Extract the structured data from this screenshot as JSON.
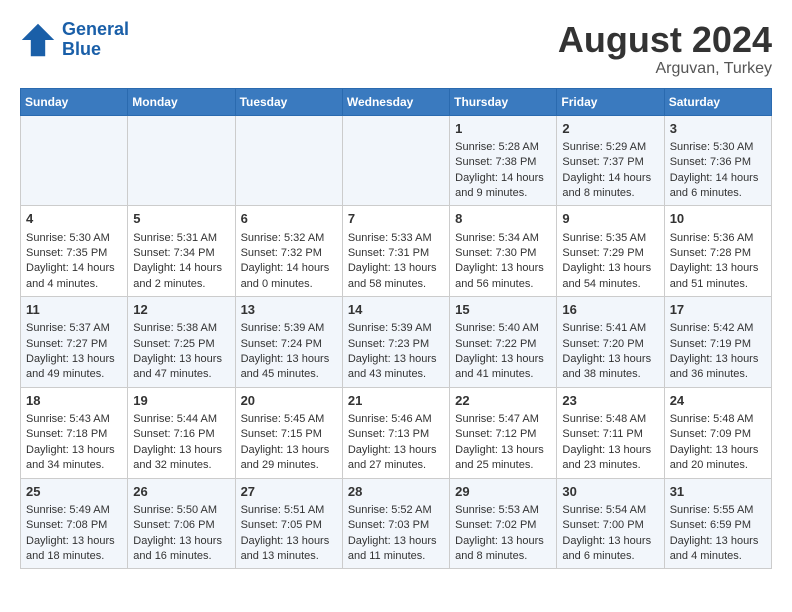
{
  "header": {
    "logo_line1": "General",
    "logo_line2": "Blue",
    "month_year": "August 2024",
    "location": "Arguvan, Turkey"
  },
  "days_of_week": [
    "Sunday",
    "Monday",
    "Tuesday",
    "Wednesday",
    "Thursday",
    "Friday",
    "Saturday"
  ],
  "weeks": [
    {
      "cells": [
        {
          "day": "",
          "content": ""
        },
        {
          "day": "",
          "content": ""
        },
        {
          "day": "",
          "content": ""
        },
        {
          "day": "",
          "content": ""
        },
        {
          "day": "1",
          "content": "Sunrise: 5:28 AM\nSunset: 7:38 PM\nDaylight: 14 hours\nand 9 minutes."
        },
        {
          "day": "2",
          "content": "Sunrise: 5:29 AM\nSunset: 7:37 PM\nDaylight: 14 hours\nand 8 minutes."
        },
        {
          "day": "3",
          "content": "Sunrise: 5:30 AM\nSunset: 7:36 PM\nDaylight: 14 hours\nand 6 minutes."
        }
      ]
    },
    {
      "cells": [
        {
          "day": "4",
          "content": "Sunrise: 5:30 AM\nSunset: 7:35 PM\nDaylight: 14 hours\nand 4 minutes."
        },
        {
          "day": "5",
          "content": "Sunrise: 5:31 AM\nSunset: 7:34 PM\nDaylight: 14 hours\nand 2 minutes."
        },
        {
          "day": "6",
          "content": "Sunrise: 5:32 AM\nSunset: 7:32 PM\nDaylight: 14 hours\nand 0 minutes."
        },
        {
          "day": "7",
          "content": "Sunrise: 5:33 AM\nSunset: 7:31 PM\nDaylight: 13 hours\nand 58 minutes."
        },
        {
          "day": "8",
          "content": "Sunrise: 5:34 AM\nSunset: 7:30 PM\nDaylight: 13 hours\nand 56 minutes."
        },
        {
          "day": "9",
          "content": "Sunrise: 5:35 AM\nSunset: 7:29 PM\nDaylight: 13 hours\nand 54 minutes."
        },
        {
          "day": "10",
          "content": "Sunrise: 5:36 AM\nSunset: 7:28 PM\nDaylight: 13 hours\nand 51 minutes."
        }
      ]
    },
    {
      "cells": [
        {
          "day": "11",
          "content": "Sunrise: 5:37 AM\nSunset: 7:27 PM\nDaylight: 13 hours\nand 49 minutes."
        },
        {
          "day": "12",
          "content": "Sunrise: 5:38 AM\nSunset: 7:25 PM\nDaylight: 13 hours\nand 47 minutes."
        },
        {
          "day": "13",
          "content": "Sunrise: 5:39 AM\nSunset: 7:24 PM\nDaylight: 13 hours\nand 45 minutes."
        },
        {
          "day": "14",
          "content": "Sunrise: 5:39 AM\nSunset: 7:23 PM\nDaylight: 13 hours\nand 43 minutes."
        },
        {
          "day": "15",
          "content": "Sunrise: 5:40 AM\nSunset: 7:22 PM\nDaylight: 13 hours\nand 41 minutes."
        },
        {
          "day": "16",
          "content": "Sunrise: 5:41 AM\nSunset: 7:20 PM\nDaylight: 13 hours\nand 38 minutes."
        },
        {
          "day": "17",
          "content": "Sunrise: 5:42 AM\nSunset: 7:19 PM\nDaylight: 13 hours\nand 36 minutes."
        }
      ]
    },
    {
      "cells": [
        {
          "day": "18",
          "content": "Sunrise: 5:43 AM\nSunset: 7:18 PM\nDaylight: 13 hours\nand 34 minutes."
        },
        {
          "day": "19",
          "content": "Sunrise: 5:44 AM\nSunset: 7:16 PM\nDaylight: 13 hours\nand 32 minutes."
        },
        {
          "day": "20",
          "content": "Sunrise: 5:45 AM\nSunset: 7:15 PM\nDaylight: 13 hours\nand 29 minutes."
        },
        {
          "day": "21",
          "content": "Sunrise: 5:46 AM\nSunset: 7:13 PM\nDaylight: 13 hours\nand 27 minutes."
        },
        {
          "day": "22",
          "content": "Sunrise: 5:47 AM\nSunset: 7:12 PM\nDaylight: 13 hours\nand 25 minutes."
        },
        {
          "day": "23",
          "content": "Sunrise: 5:48 AM\nSunset: 7:11 PM\nDaylight: 13 hours\nand 23 minutes."
        },
        {
          "day": "24",
          "content": "Sunrise: 5:48 AM\nSunset: 7:09 PM\nDaylight: 13 hours\nand 20 minutes."
        }
      ]
    },
    {
      "cells": [
        {
          "day": "25",
          "content": "Sunrise: 5:49 AM\nSunset: 7:08 PM\nDaylight: 13 hours\nand 18 minutes."
        },
        {
          "day": "26",
          "content": "Sunrise: 5:50 AM\nSunset: 7:06 PM\nDaylight: 13 hours\nand 16 minutes."
        },
        {
          "day": "27",
          "content": "Sunrise: 5:51 AM\nSunset: 7:05 PM\nDaylight: 13 hours\nand 13 minutes."
        },
        {
          "day": "28",
          "content": "Sunrise: 5:52 AM\nSunset: 7:03 PM\nDaylight: 13 hours\nand 11 minutes."
        },
        {
          "day": "29",
          "content": "Sunrise: 5:53 AM\nSunset: 7:02 PM\nDaylight: 13 hours\nand 8 minutes."
        },
        {
          "day": "30",
          "content": "Sunrise: 5:54 AM\nSunset: 7:00 PM\nDaylight: 13 hours\nand 6 minutes."
        },
        {
          "day": "31",
          "content": "Sunrise: 5:55 AM\nSunset: 6:59 PM\nDaylight: 13 hours\nand 4 minutes."
        }
      ]
    }
  ]
}
